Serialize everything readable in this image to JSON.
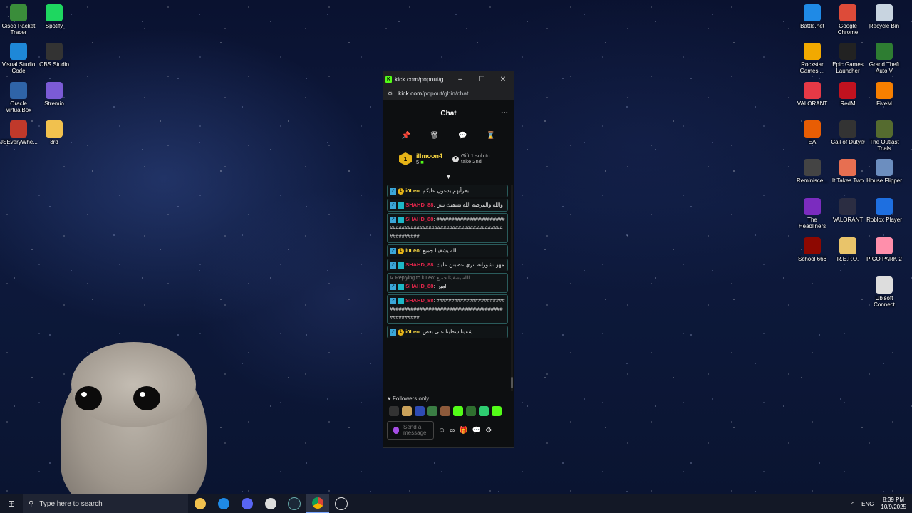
{
  "desktop": {
    "icons_left": [
      {
        "label": "Cisco Packet Tracer",
        "icon": "cisco-icon",
        "color": "#3a8d3a"
      },
      {
        "label": "Spotify",
        "icon": "spotify-icon",
        "color": "#1ed760"
      },
      {
        "label": "Visual Studio Code",
        "icon": "vscode-icon",
        "color": "#1e88d8"
      },
      {
        "label": "OBS Studio",
        "icon": "obs-icon",
        "color": "#333333"
      },
      {
        "label": "Oracle VirtualBox",
        "icon": "virtualbox-icon",
        "color": "#2f64a8"
      },
      {
        "label": "Stremio",
        "icon": "stremio-icon",
        "color": "#7b5bd6"
      },
      {
        "label": "JSEveryWhe...",
        "icon": "jseverywhere-icon",
        "color": "#c0392b"
      },
      {
        "label": "3rd",
        "icon": "folder-icon",
        "color": "#f1c14e"
      }
    ],
    "icons_right": [
      {
        "label": "Battle.net",
        "icon": "battlenet-icon",
        "color": "#1f8ae6"
      },
      {
        "label": "Google Chrome",
        "icon": "chrome-icon",
        "color": "#dd4b39"
      },
      {
        "label": "Recycle Bin",
        "icon": "recycle-bin-icon",
        "color": "#c8d4e0"
      },
      {
        "label": "Rockstar Games ...",
        "icon": "rockstar-icon",
        "color": "#f2a900"
      },
      {
        "label": "Epic Games Launcher",
        "icon": "epic-icon",
        "color": "#222222"
      },
      {
        "label": "Grand Theft Auto V",
        "icon": "gta-icon",
        "color": "#2e7d32"
      },
      {
        "label": "VALORANT",
        "icon": "valorant-icon",
        "color": "#e63946"
      },
      {
        "label": "RedM",
        "icon": "redm-icon",
        "color": "#c1121f"
      },
      {
        "label": "FiveM",
        "icon": "fivem-icon",
        "color": "#f77f00"
      },
      {
        "label": "EA",
        "icon": "ea-icon",
        "color": "#e85d04"
      },
      {
        "label": "Call of Duty®",
        "icon": "cod-icon",
        "color": "#333333"
      },
      {
        "label": "The Outlast Trials",
        "icon": "outlast-icon",
        "color": "#556b2f"
      },
      {
        "label": "Reminisce...",
        "icon": "reminisce-icon",
        "color": "#444444"
      },
      {
        "label": "It Takes Two",
        "icon": "ittakestwo-icon",
        "color": "#e76f51"
      },
      {
        "label": "House Flipper",
        "icon": "houseflipper-icon",
        "color": "#6c8ebf"
      },
      {
        "label": "The Headliners",
        "icon": "headliners-icon",
        "color": "#7b2cbf"
      },
      {
        "label": "VALORANT",
        "icon": "valorant-icon",
        "color": "#2b2d42"
      },
      {
        "label": "Roblox Player",
        "icon": "roblox-icon",
        "color": "#1e6fe0"
      },
      {
        "label": "School 666",
        "icon": "school666-icon",
        "color": "#8d0801"
      },
      {
        "label": "R.E.P.O.",
        "icon": "repo-icon",
        "color": "#e9c46a"
      },
      {
        "label": "PICO PARK 2",
        "icon": "picopark-icon",
        "color": "#ff8fab"
      },
      {
        "label": "Ubisoft Connect",
        "icon": "ubisoft-icon",
        "color": "#dddddd"
      }
    ]
  },
  "window": {
    "title": "kick.com/popout/g...",
    "url_host": "kick.com",
    "url_path": "/popout/ghin/chat",
    "chat_title": "Chat",
    "pinned": {
      "rank": "1",
      "username": "illmoon4",
      "count": "5",
      "gift_text_1": "Gift 1 sub to",
      "gift_text_2": "take 2nd"
    },
    "messages": [
      {
        "user": "i0Leo",
        "text": "بقرأبهم يدعون عليكم",
        "kind": "leo"
      },
      {
        "user": "SHAHD_88",
        "text": "والله والمرضه الله يشفيك بس",
        "kind": "shahd"
      },
      {
        "user": "SHAHD_88",
        "text": "#######################################################################",
        "kind": "shahd"
      },
      {
        "user": "i0Leo",
        "text": "الله يشفينا جميع",
        "kind": "leo"
      },
      {
        "user": "SHAHD_88",
        "text": "مهو بشورانه انزي عصبتن عليك",
        "kind": "shahd"
      },
      {
        "user": "SHAHD_88",
        "text": "امين",
        "kind": "shahd",
        "reply": "Replying to i0Leo:",
        "reply_text": "الله يشفينا جميع"
      },
      {
        "user": "SHAHD_88",
        "text": "#######################################################################",
        "kind": "shahd"
      },
      {
        "user": "i0Leo",
        "text": "شفينا سطينا على بعض",
        "kind": "leo"
      }
    ],
    "followers_only": "Followers only",
    "input_placeholder": "Send a message"
  },
  "taskbar": {
    "search_placeholder": "Type here to search",
    "language": "ENG",
    "time": "8:39 PM",
    "date": "10/9/2025"
  }
}
